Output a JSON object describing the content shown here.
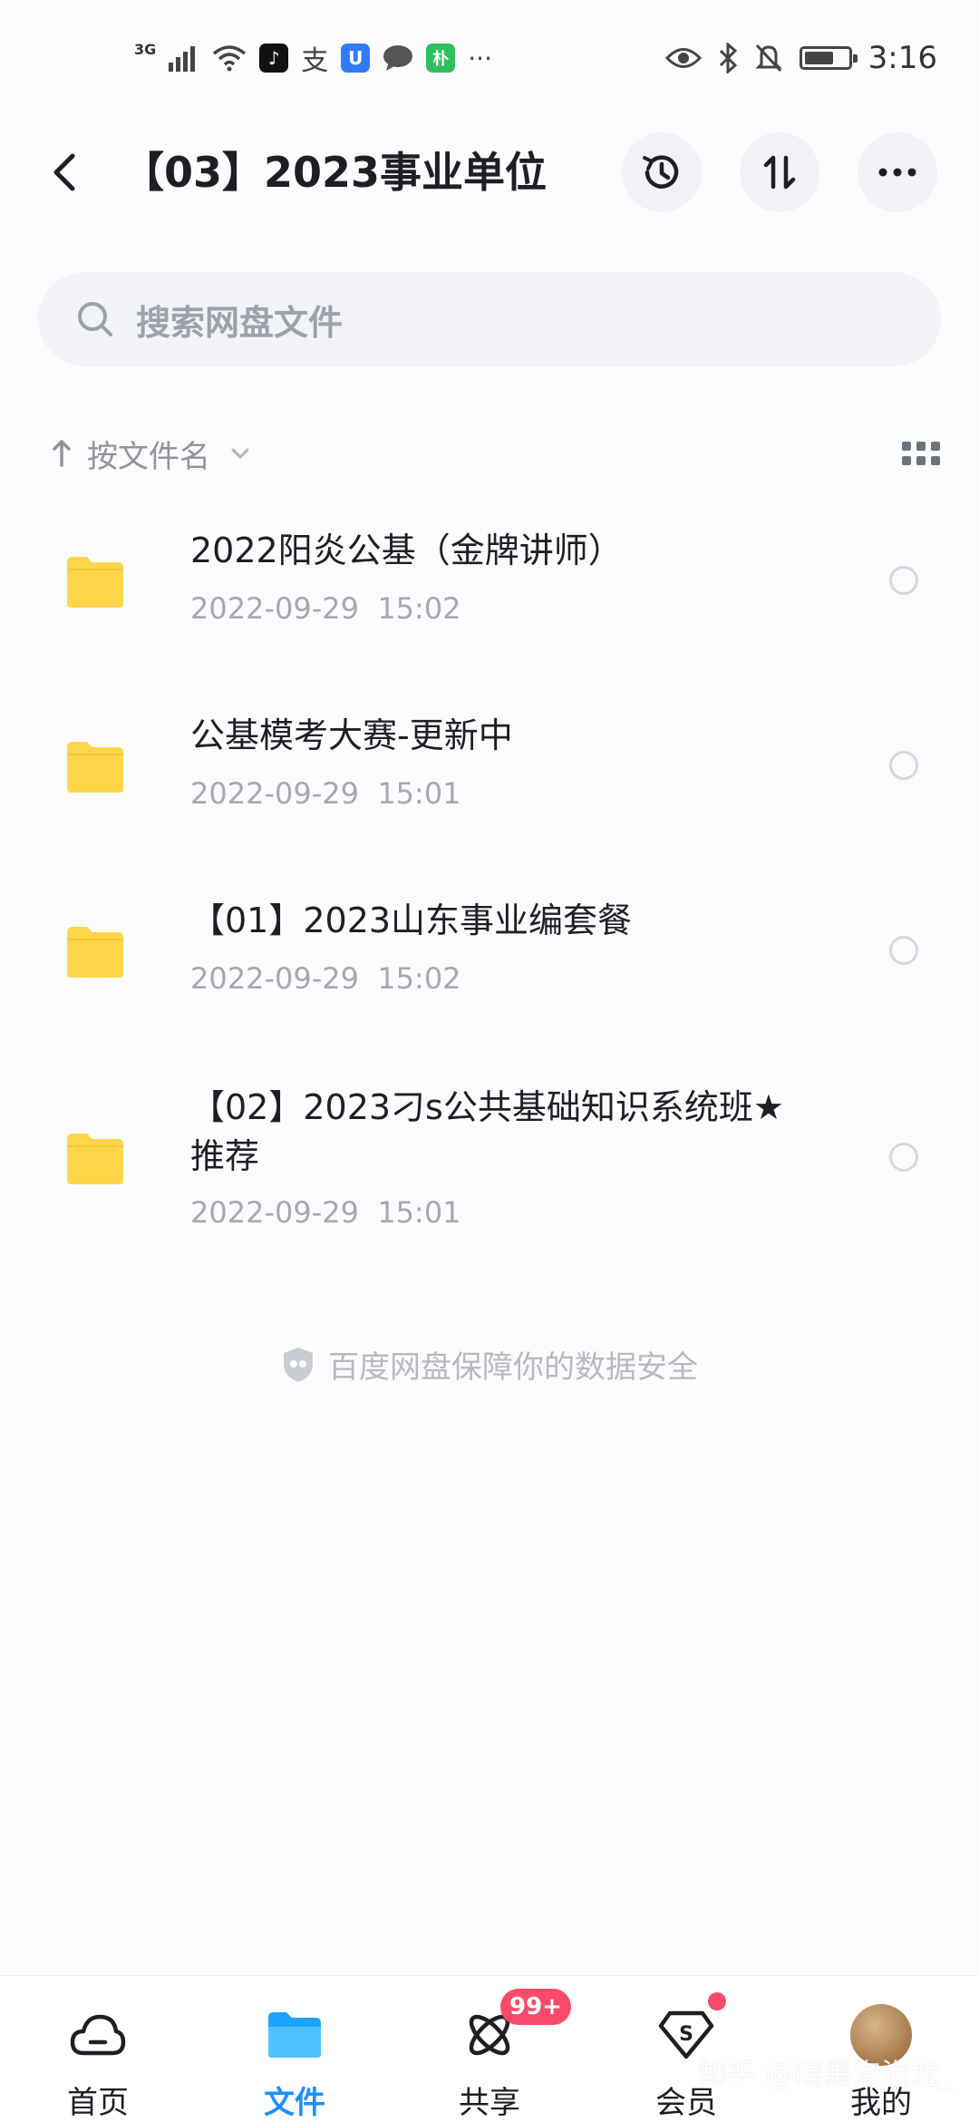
{
  "status_bar": {
    "network": "3G",
    "time": "3:16",
    "app_icons": [
      "tiktok-icon",
      "alipay-icon",
      "uc-icon",
      "chat-icon",
      "pu-icon"
    ],
    "more": "···"
  },
  "header": {
    "title": "【03】2023事业单位",
    "buttons": [
      "history-icon",
      "transfer-icon",
      "more-icon"
    ]
  },
  "search": {
    "placeholder": "搜索网盘文件"
  },
  "sort": {
    "label": "按文件名"
  },
  "files": [
    {
      "name": "2022阳炎公基（金牌讲师）",
      "date": "2022-09-29  15:02"
    },
    {
      "name": "公基模考大赛-更新中",
      "date": "2022-09-29  15:01"
    },
    {
      "name": "【01】2023山东事业编套餐",
      "date": "2022-09-29  15:02"
    },
    {
      "name": "【02】2023刁s公共基础知识系统班★推荐",
      "date": "2022-09-29  15:01"
    }
  ],
  "security_note": "百度网盘保障你的数据安全",
  "tabs": [
    {
      "label": "首页",
      "icon": "home-cloud-icon"
    },
    {
      "label": "文件",
      "icon": "folder-icon",
      "active": true
    },
    {
      "label": "共享",
      "icon": "share-atom-icon",
      "badge": "99+"
    },
    {
      "label": "会员",
      "icon": "vip-diamond-icon"
    },
    {
      "label": "我的",
      "icon": "avatar"
    }
  ],
  "watermark": "知乎 @暗黑泡泡龙_",
  "colors": {
    "accent": "#1e90ff",
    "folder": "#ffd64a",
    "badge": "#f84a6a"
  }
}
